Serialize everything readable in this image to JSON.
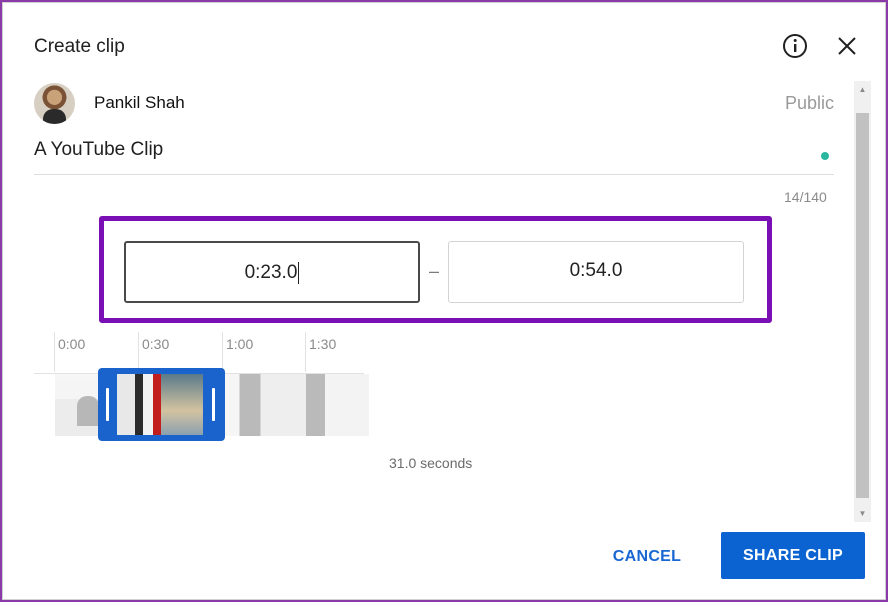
{
  "dialog": {
    "title": "Create clip",
    "info_icon": "info-icon",
    "close_icon": "close-icon"
  },
  "channel": {
    "name": "Pankil Shah",
    "visibility": "Public"
  },
  "clip": {
    "title": "A YouTube Clip",
    "char_count": "14/140"
  },
  "range": {
    "start": "0:23.0",
    "separator": "–",
    "end": "0:54.0"
  },
  "timeline": {
    "ticks": [
      "0:00",
      "0:30",
      "1:00",
      "1:30"
    ],
    "duration": "31.0 seconds"
  },
  "actions": {
    "cancel": "CANCEL",
    "share": "SHARE CLIP"
  },
  "colors": {
    "accent": "#0b63d1",
    "highlight": "#7a0fb5",
    "status_dot": "#2ab7a0"
  }
}
